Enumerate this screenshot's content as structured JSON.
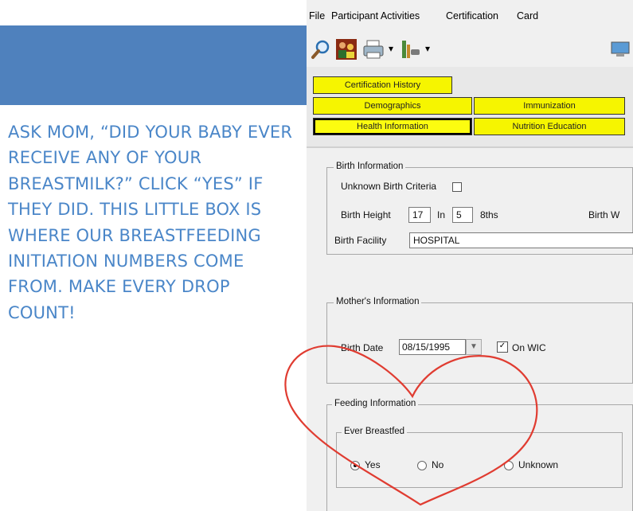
{
  "slide": {
    "instruction_text": "Ask Mom, “Did your baby ever receive any of your breastmilk?” Click “Yes” if they did. This little box is where our breastfeeding initiation numbers come from. Make every drop count!",
    "accent_color": "#4f81bd",
    "text_color": "#4a86c8",
    "heart_color": "#e03c31"
  },
  "menu": {
    "items": [
      "File",
      "Participant Activities",
      "Certification",
      "Card"
    ]
  },
  "toolbar": {
    "icons": [
      "search-icon",
      "people-icon",
      "printer-icon",
      "dropdown-arrow-icon",
      "tools-icon",
      "dropdown-arrow-icon",
      "monitor-icon"
    ]
  },
  "tabs": {
    "certification_history": "Certification History",
    "demographics": "Demographics",
    "immunization": "Immunization",
    "health_information": "Health Information",
    "nutrition_education": "Nutrition Education",
    "highlight_color": "#f6f500"
  },
  "birth_info": {
    "title": "Birth Information",
    "unknown_criteria_label": "Unknown Birth Criteria",
    "unknown_criteria_checked": false,
    "height_label": "Birth Height",
    "height_in": "17",
    "in_label": "In",
    "height_8ths": "5",
    "eighths_label": "8ths",
    "weight_label": "Birth W",
    "facility_label": "Birth Facility",
    "facility_value": "HOSPITAL"
  },
  "mother_info": {
    "title": "Mother's Information",
    "birth_date_label": "Birth Date",
    "birth_date_value": "08/15/1995",
    "on_wic_label": "On WIC",
    "on_wic_checked": true
  },
  "feeding_info": {
    "title": "Feeding Information",
    "ever_breastfed_label": "Ever Breastfed",
    "options": [
      "Yes",
      "No",
      "Unknown"
    ],
    "selected": "Yes"
  }
}
